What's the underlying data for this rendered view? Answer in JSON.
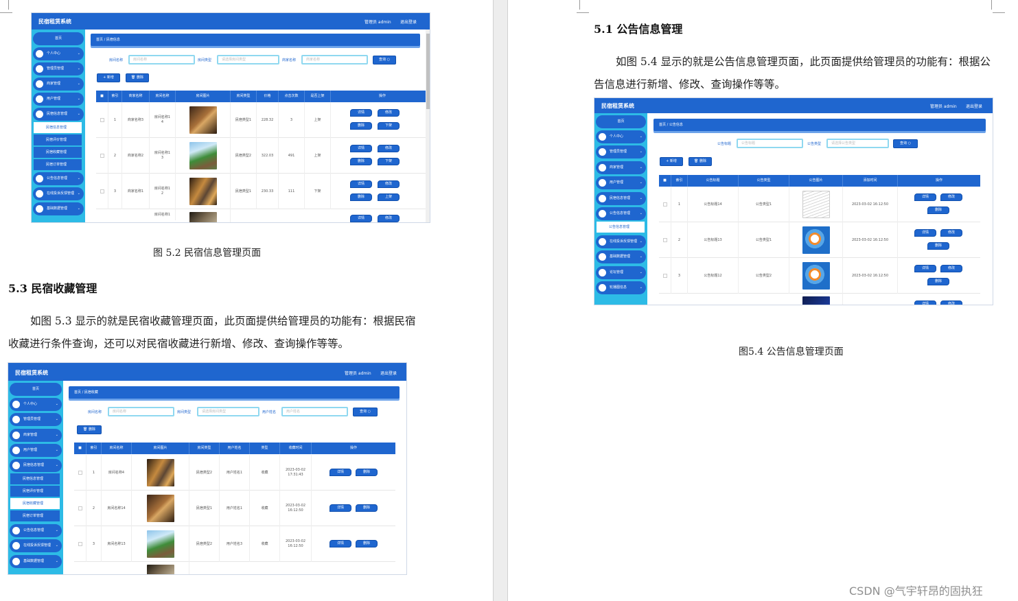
{
  "left_page": {
    "fig52": {
      "app_title": "民宿租赁系统",
      "user": "管理员 admin",
      "logout": "退出登录",
      "caption": "图 5.2  民宿信息管理页面",
      "menu": {
        "home": "首页",
        "items": [
          "个人中心",
          "管理员管理",
          "商家管理",
          "用户管理",
          "民宿信息管理"
        ],
        "subs": [
          "民宿信息管理",
          "民宿评价管理",
          "民宿收藏管理",
          "民宿订单管理"
        ],
        "items2": [
          "公告信息管理",
          "在线投诉反馈管理",
          "基础数据管理"
        ]
      },
      "breadcrumb": "首页  /  民宿信息",
      "filters": [
        {
          "label": "房间名称",
          "placeholder": "房间名称"
        },
        {
          "label": "房间类型",
          "placeholder": "请选择房间类型"
        },
        {
          "label": "商家名称",
          "placeholder": "商家名称"
        }
      ],
      "search_btn": "查询 ○",
      "add_btn": "+ 新增",
      "delete_btn": "🗑 删除",
      "columns": [
        "索引",
        "商家名称",
        "房间名称",
        "房间图片",
        "房间类型",
        "价格",
        "点击次数",
        "是否上架",
        "操作"
      ],
      "rows": [
        {
          "idx": "1",
          "merchant": "商家名称3",
          "room": "房间名称1\n4",
          "type": "民宿类型1",
          "price": "228.32",
          "clicks": "3",
          "status": "上架",
          "toggle": "下架"
        },
        {
          "idx": "2",
          "merchant": "商家名称2",
          "room": "房间名称1\n3",
          "type": "民宿类型2",
          "price": "322.03",
          "clicks": "491",
          "status": "上架",
          "toggle": "下架"
        },
        {
          "idx": "3",
          "merchant": "商家名称1",
          "room": "房间名称1\n2",
          "type": "民宿类型1",
          "price": "230.33",
          "clicks": "111",
          "status": "下架",
          "toggle": "上架"
        },
        {
          "idx": "",
          "merchant": "",
          "room": "房间名称1",
          "type": "",
          "price": "",
          "clicks": "",
          "status": "",
          "toggle": ""
        }
      ],
      "op_labels": {
        "detail": "详情",
        "edit": "修改",
        "delete": "删除"
      }
    },
    "section53": {
      "heading": "5.3 民宿收藏管理",
      "para": "如图 5.3 显示的就是民宿收藏管理页面，此页面提供给管理员的功能有：根据民宿收藏进行条件查询，还可以对民宿收藏进行新增、修改、查询操作等等。"
    },
    "fig53": {
      "app_title": "民宿租赁系统",
      "user": "管理员 admin",
      "logout": "退出登录",
      "menu": {
        "home": "首页",
        "items": [
          "个人中心",
          "管理员管理",
          "商家管理",
          "用户管理",
          "民宿信息管理"
        ],
        "subs": [
          "民宿信息管理",
          "民宿评价管理",
          "民宿收藏管理",
          "民宿订单管理"
        ],
        "items2": [
          "公告信息管理",
          "在线投诉反馈管理",
          "基础数据管理"
        ]
      },
      "breadcrumb": "首页  /  民宿收藏",
      "filters": [
        {
          "label": "房间名称",
          "placeholder": "房间名称"
        },
        {
          "label": "房间类型",
          "placeholder": "请选择房间类型"
        },
        {
          "label": "用户姓名",
          "placeholder": "用户姓名"
        }
      ],
      "search_btn": "查询 ○",
      "delete_btn": "🗑 删除",
      "columns": [
        "索引",
        "房间名称",
        "房间图片",
        "房间类型",
        "用户姓名",
        "类型",
        "收藏时间",
        "操作"
      ],
      "rows": [
        {
          "idx": "1",
          "room": "房间名称4",
          "type": "民宿类型2",
          "user": "用户姓名1",
          "kind": "收藏",
          "time": "2023-03-02\n17:31:43"
        },
        {
          "idx": "2",
          "room": "房间名称14",
          "type": "民宿类型1",
          "user": "用户姓名1",
          "kind": "收藏",
          "time": "2023-03-02\n16:12:50"
        },
        {
          "idx": "3",
          "room": "房间名称13",
          "type": "民宿类型2",
          "user": "用户姓名3",
          "kind": "收藏",
          "time": "2023-03-02\n16:12:50"
        }
      ],
      "op_labels": {
        "detail": "详情",
        "delete": "删除"
      }
    }
  },
  "right_page": {
    "section51": {
      "heading": "5.1 公告信息管理",
      "para": "如图 5.4 显示的就是公告信息管理页面，此页面提供给管理员的功能有：根据公告信息进行新增、修改、查询操作等等。"
    },
    "fig54": {
      "app_title": "民宿租赁系统",
      "user": "管理员 admin",
      "logout": "退出登录",
      "caption": "图5.4  公告信息管理页面",
      "menu": {
        "home": "首页",
        "items": [
          "个人中心",
          "管理员管理",
          "商家管理",
          "用户管理",
          "民宿信息管理",
          "公告信息管理"
        ],
        "subs": [
          "公告信息管理"
        ],
        "items2": [
          "在线投诉反馈管理",
          "基础数据管理",
          "论坛管理",
          "轮播图信息"
        ]
      },
      "breadcrumb": "首页  /  公告信息",
      "filters": [
        {
          "label": "公告标题",
          "placeholder": "公告标题"
        },
        {
          "label": "公告类型",
          "placeholder": "请选择公告类型"
        }
      ],
      "search_btn": "查询 ○",
      "add_btn": "+ 新增",
      "delete_btn": "🗑 删除",
      "columns": [
        "索引",
        "公告标题",
        "公告类型",
        "公告图片",
        "添加时间",
        "操作"
      ],
      "rows": [
        {
          "idx": "1",
          "title": "公告标题14",
          "type": "公告类型1",
          "time": "2023-03-02 16:12:50"
        },
        {
          "idx": "2",
          "title": "公告标题13",
          "type": "公告类型1",
          "time": "2023-03-02 16:12:50"
        },
        {
          "idx": "3",
          "title": "公告标题12",
          "type": "公告类型2",
          "time": "2023-03-02 16:12:50"
        }
      ],
      "op_labels": {
        "detail": "详情",
        "edit": "修改",
        "delete": "删除"
      }
    },
    "watermark": "CSDN @气宇轩昂的固执狂"
  }
}
